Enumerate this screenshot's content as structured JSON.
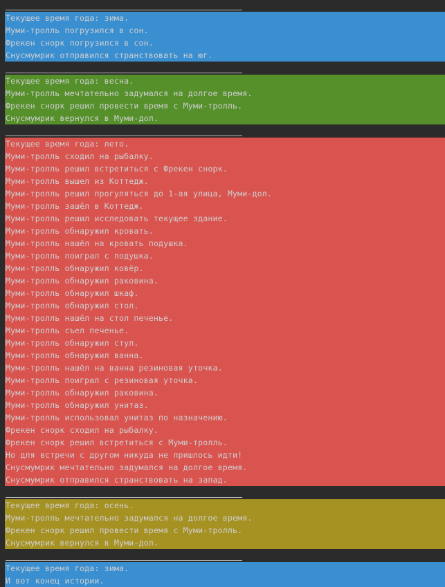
{
  "colors": {
    "background": "#2b2b2b",
    "separator": "#bdbdbd",
    "text": "#cfcfcf",
    "winter": "#3a8fd1",
    "spring": "#55902a",
    "summer": "#d9534f",
    "autumn": "#a69123"
  },
  "blocks": [
    {
      "season": "winter",
      "lines": [
        "Текущее время года: зима.",
        "Муми-тролль погрузился в сон.",
        "Фрекен снорк погрузился в сон.",
        "Снусмумрик отправился странствовать на юг."
      ]
    },
    {
      "season": "spring",
      "lines": [
        "Текущее время года: весна.",
        "Муми-тролль мечтательно задумался на долгое время.",
        "Фрекен снорк решил провести время с Муми-тролль.",
        "Снусмумрик вернулся в Муми-дол."
      ]
    },
    {
      "season": "summer",
      "lines": [
        "Текущее время года: лето.",
        "Муми-тролль сходил на рыбалку.",
        "Муми-тролль решил встретиться с Фрекен снорк.",
        "Муми-тролль вышел из Коттедж.",
        "Муми-тролль решил прогуляться до 1-ая улица, Муми-дол.",
        "Муми-тролль зашёл в Коттедж.",
        "Муми-тролль решил исследовать текущее здание.",
        "Муми-тролль обнаружил кровать.",
        "Муми-тролль нашёл на кровать подушка.",
        "Муми-тролль поиграл с подушка.",
        "Муми-тролль обнаружил ковёр.",
        "Муми-тролль обнаружил раковина.",
        "Муми-тролль обнаружил шкаф.",
        "Муми-тролль обнаружил стол.",
        "Муми-тролль нашёл на стол печенье.",
        "Муми-тролль съел печенье.",
        "Муми-тролль обнаружил стул.",
        "Муми-тролль обнаружил ванна.",
        "Муми-тролль нашёл на ванна резиновая уточка.",
        "Муми-тролль поиграл с резиновая уточка.",
        "Муми-тролль обнаружил раковина.",
        "Муми-тролль обнаружил унитаз.",
        "Муми-тролль использовал унитаз по назначению.",
        "Фрекен снорк сходил на рыбалку.",
        "Фрекен снорк решил встретиться с Муми-тролль.",
        "Но для встречи с другом никуда не пришлось идти!",
        "Снусмумрик мечтательно задумался на долгое время.",
        "Снусмумрик отправился странствовать на запад."
      ]
    },
    {
      "season": "autumn",
      "lines": [
        "Текущее время года: осень.",
        "Муми-тролль мечтательно задумался на долгое время.",
        "Фрекен снорк решил провести время с Муми-тролль.",
        "Снусмумрик вернулся в Муми-дол."
      ]
    },
    {
      "season": "winter",
      "lines": [
        "Текущее время года: зима.",
        "И вот конец истории."
      ]
    }
  ]
}
